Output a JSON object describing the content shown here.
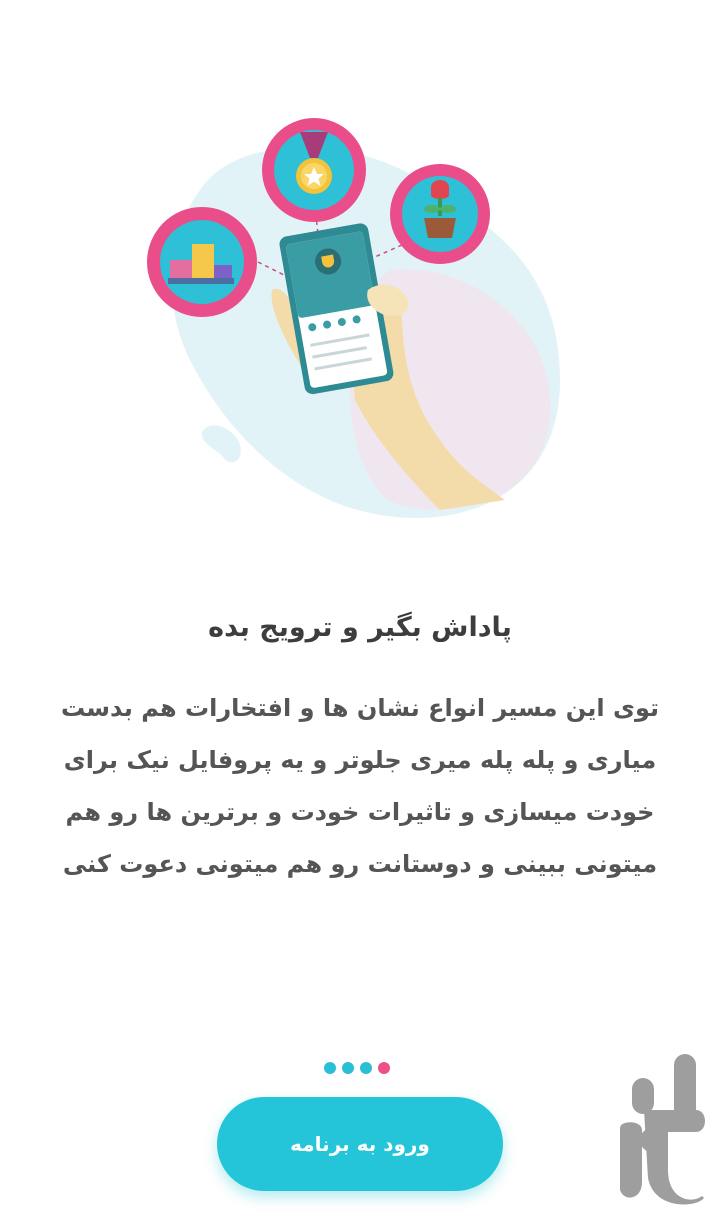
{
  "onboarding": {
    "title": "پاداش بگیر و ترویج بده",
    "description_lines": [
      "توی این مسیر انواع نشان ها و افتخارات هم بدست",
      "میاری و پله پله میری جلوتر و یه پروفایل نیک برای",
      "خودت میسازی و تاثیرات خودت و برترین ها رو هم",
      "میتونی ببینی و دوستانت رو هم میتونی دعوت کنی"
    ],
    "pagination": {
      "total": 4,
      "active_index": 3
    },
    "cta_label": "ورود به برنامه"
  },
  "illustration": {
    "icons": [
      "podium-icon",
      "medal-icon",
      "flower-pot-icon",
      "phone-in-hand"
    ],
    "colors": {
      "badge_ring": "#ea4e8a",
      "badge_inner": "#2dc0d6",
      "blob": "#dff1f5",
      "phone": "#2e8a93"
    }
  },
  "watermark": {
    "text": "بازار",
    "icon": "bazaar-logo-icon"
  }
}
